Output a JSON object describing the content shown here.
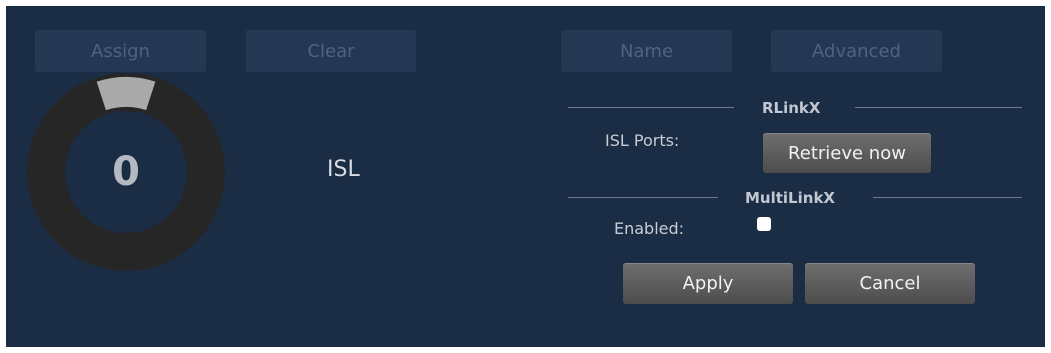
{
  "toolbar": {
    "assign_label": "Assign",
    "clear_label": "Clear",
    "name_label": "Name",
    "advanced_label": "Advanced"
  },
  "gauge": {
    "count": "0",
    "label": "ISL",
    "fill_fraction": 0.1
  },
  "rlinkx": {
    "title": "RLinkX",
    "isl_ports_label": "ISL Ports:",
    "retrieve_label": "Retrieve now"
  },
  "multilinkx": {
    "title": "MultiLinkX",
    "enabled_label": "Enabled:",
    "enabled": false
  },
  "actions": {
    "apply_label": "Apply",
    "cancel_label": "Cancel"
  },
  "colors": {
    "panel_bg": "#1b2c45",
    "ring_track": "#262626",
    "ring_segment": "#aaaaaa"
  }
}
